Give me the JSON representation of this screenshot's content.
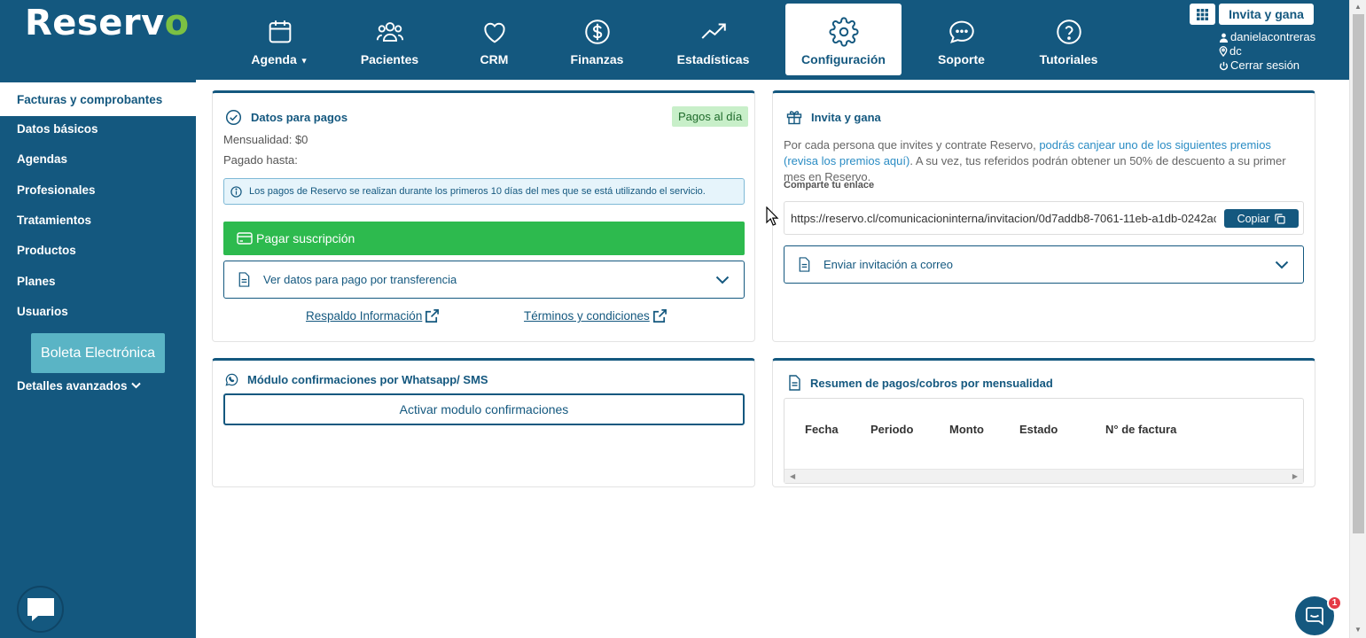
{
  "brand": {
    "logo_text": "Reserv",
    "logo_check": "o"
  },
  "nav": [
    {
      "label": "Agenda",
      "icon": "calendar-icon",
      "dropdown": true
    },
    {
      "label": "Pacientes",
      "icon": "users-icon"
    },
    {
      "label": "CRM",
      "icon": "heart-icon"
    },
    {
      "label": "Finanzas",
      "icon": "dollar-circle-icon"
    },
    {
      "label": "Estadísticas",
      "icon": "trending-up-icon"
    },
    {
      "label": "Configuración",
      "icon": "gear-icon",
      "active": true
    },
    {
      "label": "Soporte",
      "icon": "chat-bubble-icon"
    },
    {
      "label": "Tutoriales",
      "icon": "help-circle-icon"
    }
  ],
  "topright": {
    "invite_label": "Invita y gana",
    "username": "danielacontreras",
    "location": "dc",
    "logout": "Cerrar sesión"
  },
  "sidebar": {
    "items": [
      {
        "label": "Facturas y comprobantes",
        "active": true
      },
      {
        "label": "Datos básicos"
      },
      {
        "label": "Agendas"
      },
      {
        "label": "Profesionales"
      },
      {
        "label": "Tratamientos"
      },
      {
        "label": "Productos"
      },
      {
        "label": "Planes"
      },
      {
        "label": "Usuarios"
      }
    ],
    "boleta_label": "Boleta Electrónica",
    "advanced_label": "Detalles avanzados"
  },
  "payments": {
    "title": "Datos para pagos",
    "status_badge": "Pagos al día",
    "monthly": "Mensualidad: $0",
    "paid_until": "Pagado hasta:",
    "info": "Los pagos de Reservo se realizan durante los primeros 10 días del mes que se está utilizando el servicio.",
    "pay_button": "Pagar suscripción",
    "transfer_label": "Ver datos para pago por transferencia",
    "link_backup": "Respaldo Información",
    "link_terms": "Términos y condiciones"
  },
  "invite": {
    "title": "Invita y gana",
    "text_a": "Por cada persona que invites y contrate Reservo, ",
    "text_link": "podrás canjear uno de los siguientes premios (revisa los premios aquí)",
    "text_b": ". A su vez, tus referidos podrán obtener un 50% de descuento a su primer mes en Reservo.",
    "share_label": "Comparte tu enlace",
    "share_url": "https://reservo.cl/comunicacioninterna/invitacion/0d7addb8-7061-11eb-a1db-0242ac",
    "copy_label": "Copiar",
    "email_label": "Enviar invitación a correo"
  },
  "whatsapp": {
    "title": "Módulo confirmaciones por Whatsapp/ SMS",
    "button": "Activar modulo confirmaciones"
  },
  "summary": {
    "title": "Resumen de pagos/cobros por mensualidad",
    "columns": [
      "Fecha",
      "Periodo",
      "Monto",
      "Estado",
      "N° de factura"
    ]
  },
  "launcher_badge": "1",
  "colors": {
    "primary": "#14587f",
    "accent_green": "#2dba4e",
    "logo_check": "#7bc043",
    "boleta": "#5ab4c5"
  }
}
